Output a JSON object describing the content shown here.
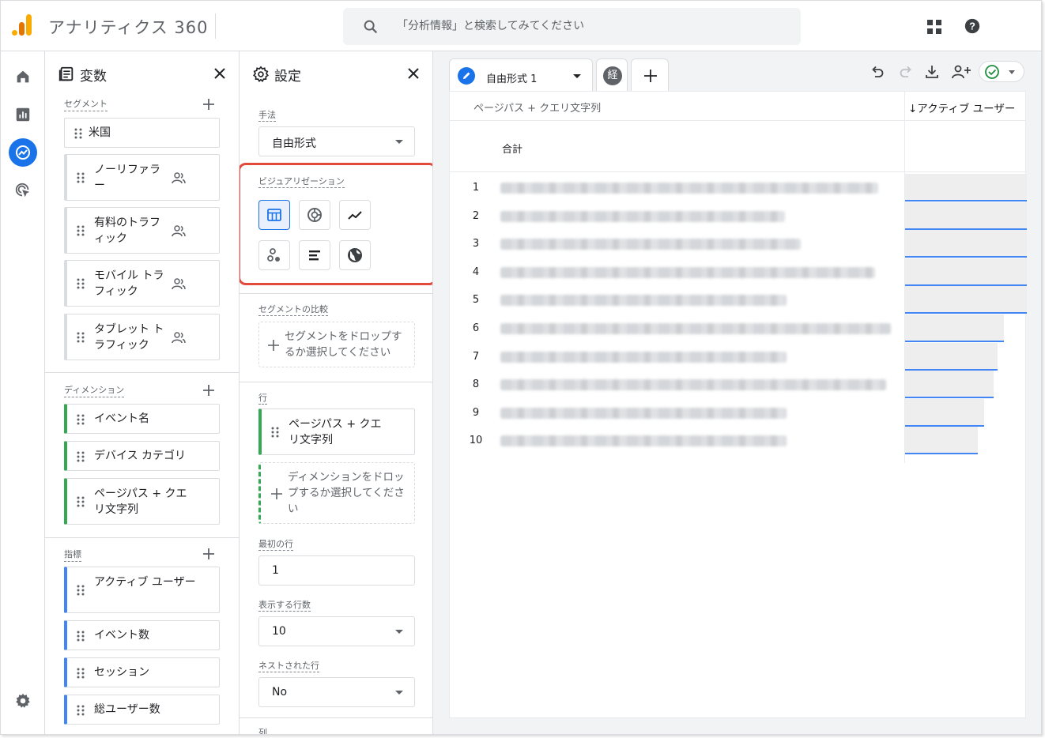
{
  "app": {
    "title": "アナリティクス 360"
  },
  "search": {
    "placeholder": "「分析情報」と検索してみてください"
  },
  "nav": {
    "items": [
      {
        "name": "home",
        "icon": "home-icon"
      },
      {
        "name": "reports",
        "icon": "bar-chart-icon"
      },
      {
        "name": "explore",
        "icon": "explore-icon",
        "active": true
      },
      {
        "name": "advertising",
        "icon": "cursor-target-icon"
      }
    ],
    "bottom_icon": "settings-gear-icon"
  },
  "variables": {
    "title": "変数",
    "segments": {
      "label": "セグメント",
      "items": [
        "米国",
        "ノーリファラー",
        "有料のトラフィック",
        "モバイル トラフィック",
        "タブレット トラフィック"
      ]
    },
    "dimensions": {
      "label": "ディメンション",
      "items": [
        "イベント名",
        "デバイス カテゴリ",
        "ページパス + クエリ文字列"
      ]
    },
    "metrics": {
      "label": "指標",
      "items": [
        "アクティブ ユーザー",
        "イベント数",
        "セッション",
        "総ユーザー数"
      ]
    }
  },
  "settings": {
    "title": "設定",
    "technique": {
      "label": "手法",
      "value": "自由形式"
    },
    "visualization": {
      "label": "ビジュアリゼーション",
      "options": [
        "table-icon",
        "donut-chart-icon",
        "line-chart-icon",
        "scatter-chart-icon",
        "bar-chart-icon",
        "geo-map-icon"
      ]
    },
    "segment_compare": {
      "label": "セグメントの比較",
      "drop_text": "セグメントをドロップするか選択してください"
    },
    "rows": {
      "label": "行",
      "item": "ページパス + クエリ文字列",
      "drop_text": "ディメンションをドロップするか選択してください"
    },
    "first_row": {
      "label": "最初の行",
      "value": "1"
    },
    "show_rows": {
      "label": "表示する行数",
      "value": "10"
    },
    "nested_rows": {
      "label": "ネストされた行",
      "value": "No"
    },
    "columns": {
      "label": "列"
    }
  },
  "canvas": {
    "tab_label": "自由形式 1",
    "tab2_badge": "経",
    "status_color": "#1e8e3e",
    "table": {
      "dim_header": "ページパス + クエリ文字列",
      "metric_header": "↓アクティブ ユーザー",
      "total_label": "合計",
      "rows": [
        {
          "num": "1",
          "bar": 1.0
        },
        {
          "num": "2",
          "bar": 1.0
        },
        {
          "num": "3",
          "bar": 1.0
        },
        {
          "num": "4",
          "bar": 1.0
        },
        {
          "num": "5",
          "bar": 1.0
        },
        {
          "num": "6",
          "bar": 0.81
        },
        {
          "num": "7",
          "bar": 0.76
        },
        {
          "num": "8",
          "bar": 0.73
        },
        {
          "num": "9",
          "bar": 0.65
        },
        {
          "num": "10",
          "bar": 0.6
        }
      ]
    }
  },
  "colors": {
    "accent": "#1a73e8",
    "dimension": "#34a853",
    "metric": "#4285f4",
    "highlight": "#e24a3b"
  }
}
